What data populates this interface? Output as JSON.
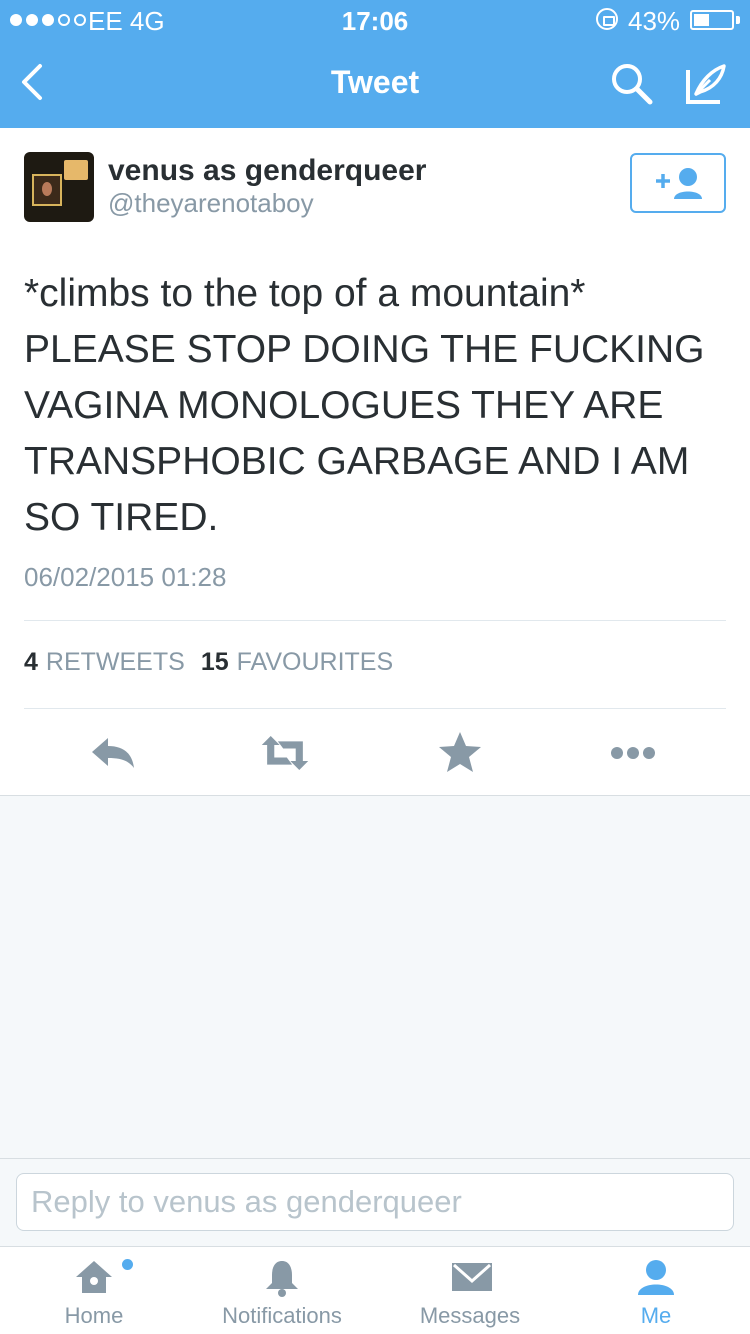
{
  "status_bar": {
    "carrier": "EE  4G",
    "time": "17:06",
    "battery": "43%",
    "battery_level": 0.43
  },
  "nav": {
    "title": "Tweet",
    "back_icon": "chevron-left-icon",
    "search_icon": "search-icon",
    "compose_icon": "compose-icon"
  },
  "tweet": {
    "display_name": "venus as genderqueer",
    "handle": "@theyarenotaboy",
    "text": "*climbs to the top of a mountain*\nPLEASE STOP DOING THE FUCKING VAGINA MONOLOGUES THEY ARE TRANSPHOBIC GARBAGE AND I AM SO TIRED.",
    "timestamp": "06/02/2015 01:28",
    "retweets_count": "4",
    "retweets_label": "RETWEETS",
    "favourites_count": "15",
    "favourites_label": "FAVOURITES"
  },
  "actions": [
    "reply-icon",
    "retweet-icon",
    "favourite-star-icon",
    "more-icon"
  ],
  "reply": {
    "placeholder": "Reply to venus as genderqueer"
  },
  "tabs": [
    {
      "label": "Home",
      "icon": "home-icon"
    },
    {
      "label": "Notifications",
      "icon": "bell-icon"
    },
    {
      "label": "Messages",
      "icon": "envelope-icon"
    },
    {
      "label": "Me",
      "icon": "person-icon"
    }
  ],
  "colors": {
    "accent": "#55acee",
    "text": "#292f33",
    "muted": "#8899a6",
    "background": "#f5f8fa"
  }
}
